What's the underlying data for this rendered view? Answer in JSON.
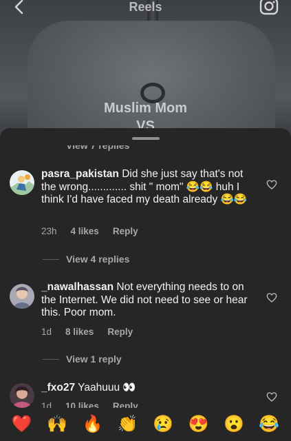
{
  "header": {
    "title": "Reels",
    "overlay_line1": "Muslim Mom",
    "overlay_line2": "VS"
  },
  "sheet": {
    "cut_replies_label": "View 7 replies"
  },
  "comments": [
    {
      "username": "pasra_pakistan",
      "text": "Did she just say that's not the wrong............. shit \" mom\" 😂😂 huh I think I'd have faced my death already 😂😂",
      "time": "23h",
      "likes": "4 likes",
      "reply": "Reply",
      "view_replies": "View 4 replies"
    },
    {
      "username": "_nawalhassan",
      "text": "Not everything needs to on the Internet.  We did not need to see or hear this. Poor mom.",
      "time": "1d",
      "likes": "8 likes",
      "reply": "Reply",
      "view_replies": "View 1 reply"
    },
    {
      "username": "_fxo27",
      "text": "Yaahuuu 👀",
      "time": "1d",
      "likes": "10 likes",
      "reply": "Reply"
    }
  ],
  "emoji_bar": [
    "❤️",
    "🙌",
    "🔥",
    "👏",
    "😢",
    "😍",
    "😮",
    "😂"
  ],
  "colors": {
    "sheet_bg": "#262626",
    "muted_text": "#a8a8a8",
    "heart_red": "#ed4956"
  },
  "icons": [
    "back-chevron-icon",
    "camera-icon",
    "heart-outline-icon"
  ]
}
